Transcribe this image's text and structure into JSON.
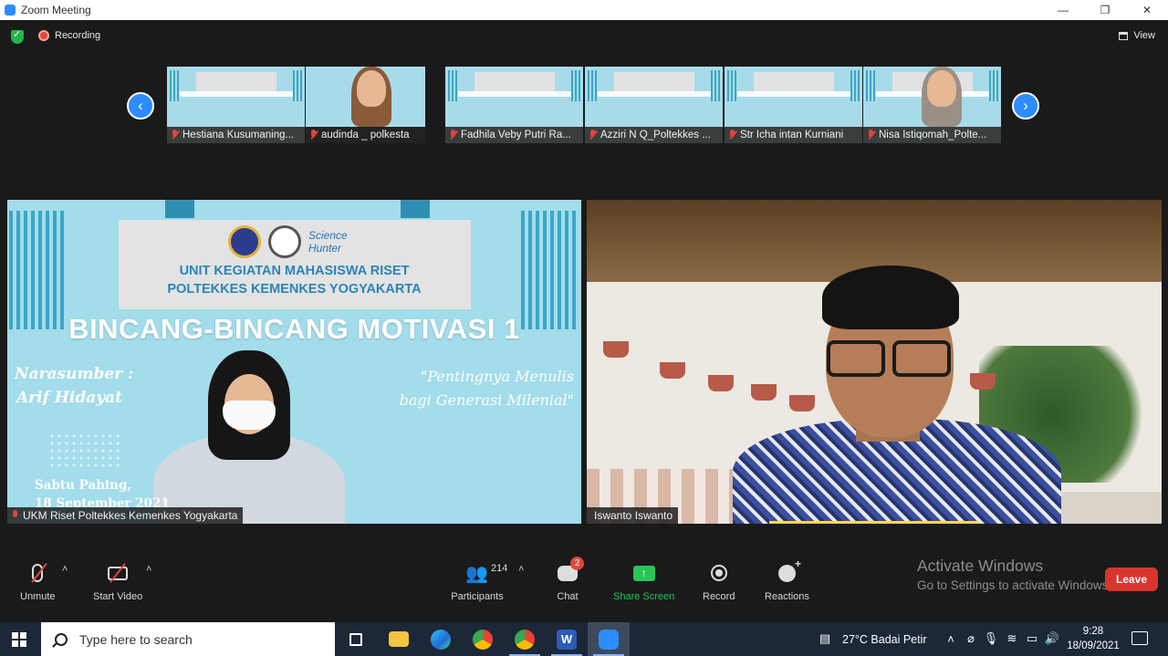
{
  "window": {
    "title": "Zoom Meeting",
    "controls": [
      "—",
      "❐",
      "✕"
    ]
  },
  "status": {
    "recording_label": "Recording",
    "view_label": "View"
  },
  "thumbnails": [
    {
      "name": "Hestiana Kusumaning...",
      "muted": true
    },
    {
      "name": "audinda _ polkesta",
      "muted": true
    },
    {
      "name": "Fadhila Veby Putri Ra...",
      "muted": true
    },
    {
      "name": "Azziri N Q_Poltekkes ...",
      "muted": true
    },
    {
      "name": "Str Icha intan Kurniani",
      "muted": true
    },
    {
      "name": "Nisa Istiqomah_Polte...",
      "muted": true
    }
  ],
  "main_tiles": {
    "left": {
      "name": "UKM Riset Poltekkes Kemenkes Yogyakarta",
      "slide": {
        "logo_text": "Science Hunter",
        "org_line1": "UNIT KEGIATAN MAHASISWA RISET",
        "org_line2": "POLTEKKES KEMENKES YOGYAKARTA",
        "title": "BINCANG-BINCANG MOTIVASI 1",
        "narasumber_label": "Narasumber :",
        "narasumber_name": "Arif Hidayat",
        "quote_line1": "\"Pentingnya Menulis",
        "quote_line2": "bagi Generasi Milenial\"",
        "date_line1": "Sabtu Pahing,",
        "date_line2": "18 September 2021"
      }
    },
    "right": {
      "name": "Iswanto Iswanto"
    }
  },
  "watermark": {
    "line1": "Activate Windows",
    "line2": "Go to Settings to activate Windows."
  },
  "toolbar": {
    "unmute": "Unmute",
    "start_video": "Start Video",
    "participants": "Participants",
    "participants_count": "214",
    "chat": "Chat",
    "chat_badge": "2",
    "share_screen": "Share Screen",
    "record": "Record",
    "reactions": "Reactions",
    "leave": "Leave"
  },
  "taskbar": {
    "search_placeholder": "Type here to search",
    "weather": "27°C  Badai Petir",
    "time": "9:28",
    "date": "18/09/2021"
  },
  "colors": {
    "zoom_blue": "#2d8cff",
    "leave_red": "#d9352e",
    "share_green": "#29c55a",
    "recording_red": "#e0453d"
  }
}
